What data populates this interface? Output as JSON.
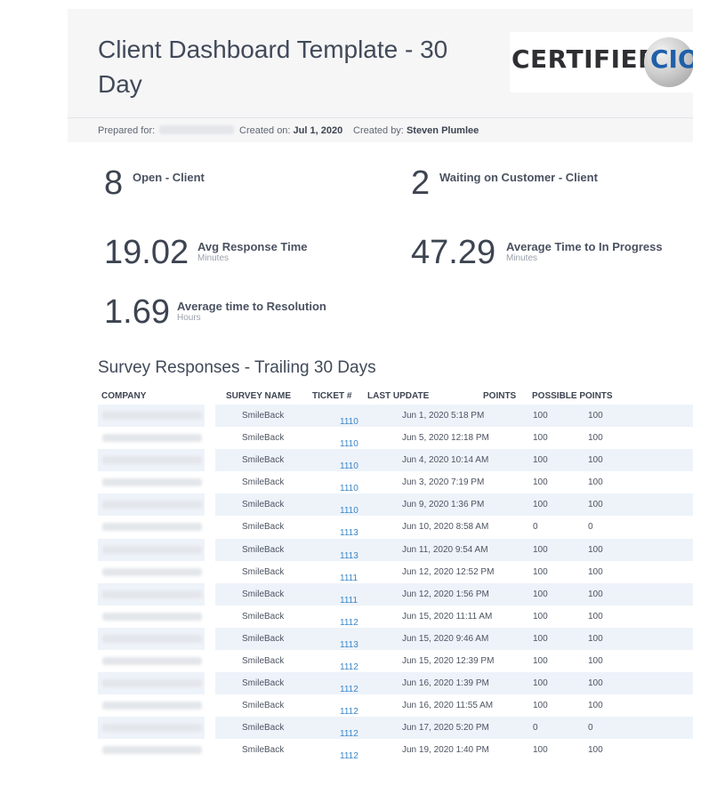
{
  "header": {
    "title": "Client Dashboard Template - 30 Day",
    "logo_text": "CERTIFIED",
    "logo_ci": "CI",
    "logo_o": "O"
  },
  "subbar": {
    "prepared_for_label": "Prepared for:",
    "created_on_label": "Created on:",
    "created_on_value": "Jul 1, 2020",
    "created_by_label": "Created by:",
    "created_by_value": "Steven Plumlee"
  },
  "metrics": {
    "open": {
      "value": "8",
      "label": "Open - Client"
    },
    "waiting": {
      "value": "2",
      "label": "Waiting on Customer - Client"
    },
    "avg_response": {
      "value": "19.02",
      "label": "Avg Response Time",
      "unit": "Minutes"
    },
    "avg_in_progress": {
      "value": "47.29",
      "label": "Average Time to In Progress",
      "unit": "Minutes"
    },
    "avg_resolution": {
      "value": "1.69",
      "label": "Average time to Resolution",
      "unit": "Hours"
    }
  },
  "survey": {
    "title": "Survey Responses - Trailing 30 Days",
    "columns": [
      "COMPANY",
      "SURVEY NAME",
      "TICKET #",
      "LAST UPDATE",
      "POINTS",
      "POSSIBLE POINTS"
    ],
    "rows": [
      {
        "survey": "SmileBack",
        "ticket": "1110",
        "updated": "Jun 1, 2020 5:18 PM",
        "points": "100",
        "possible": "100"
      },
      {
        "survey": "SmileBack",
        "ticket": "1110",
        "updated": "Jun 5, 2020 12:18 PM",
        "points": "100",
        "possible": "100"
      },
      {
        "survey": "SmileBack",
        "ticket": "1110",
        "updated": "Jun 4, 2020 10:14 AM",
        "points": "100",
        "possible": "100"
      },
      {
        "survey": "SmileBack",
        "ticket": "1110",
        "updated": "Jun 3, 2020 7:19 PM",
        "points": "100",
        "possible": "100"
      },
      {
        "survey": "SmileBack",
        "ticket": "1110",
        "updated": "Jun 9, 2020 1:36 PM",
        "points": "100",
        "possible": "100"
      },
      {
        "survey": "SmileBack",
        "ticket": "1113",
        "updated": "Jun 10, 2020 8:58 AM",
        "points": "0",
        "possible": "0"
      },
      {
        "survey": "SmileBack",
        "ticket": "1113",
        "updated": "Jun 11, 2020 9:54 AM",
        "points": "100",
        "possible": "100"
      },
      {
        "survey": "SmileBack",
        "ticket": "1111",
        "updated": "Jun 12, 2020 12:52 PM",
        "points": "100",
        "possible": "100"
      },
      {
        "survey": "SmileBack",
        "ticket": "1111",
        "updated": "Jun 12, 2020 1:56 PM",
        "points": "100",
        "possible": "100"
      },
      {
        "survey": "SmileBack",
        "ticket": "1112",
        "updated": "Jun 15, 2020 11:11 AM",
        "points": "100",
        "possible": "100"
      },
      {
        "survey": "SmileBack",
        "ticket": "1113",
        "updated": "Jun 15, 2020 9:46 AM",
        "points": "100",
        "possible": "100"
      },
      {
        "survey": "SmileBack",
        "ticket": "1112",
        "updated": "Jun 15, 2020 12:39 PM",
        "points": "100",
        "possible": "100"
      },
      {
        "survey": "SmileBack",
        "ticket": "1112",
        "updated": "Jun 16, 2020 1:39 PM",
        "points": "100",
        "possible": "100"
      },
      {
        "survey": "SmileBack",
        "ticket": "1112",
        "updated": "Jun 16, 2020 11:55 AM",
        "points": "100",
        "possible": "100"
      },
      {
        "survey": "SmileBack",
        "ticket": "1112",
        "updated": "Jun 17, 2020 5:20 PM",
        "points": "0",
        "possible": "0"
      },
      {
        "survey": "SmileBack",
        "ticket": "1112",
        "updated": "Jun 19, 2020 1:40 PM",
        "points": "100",
        "possible": "100"
      }
    ]
  }
}
